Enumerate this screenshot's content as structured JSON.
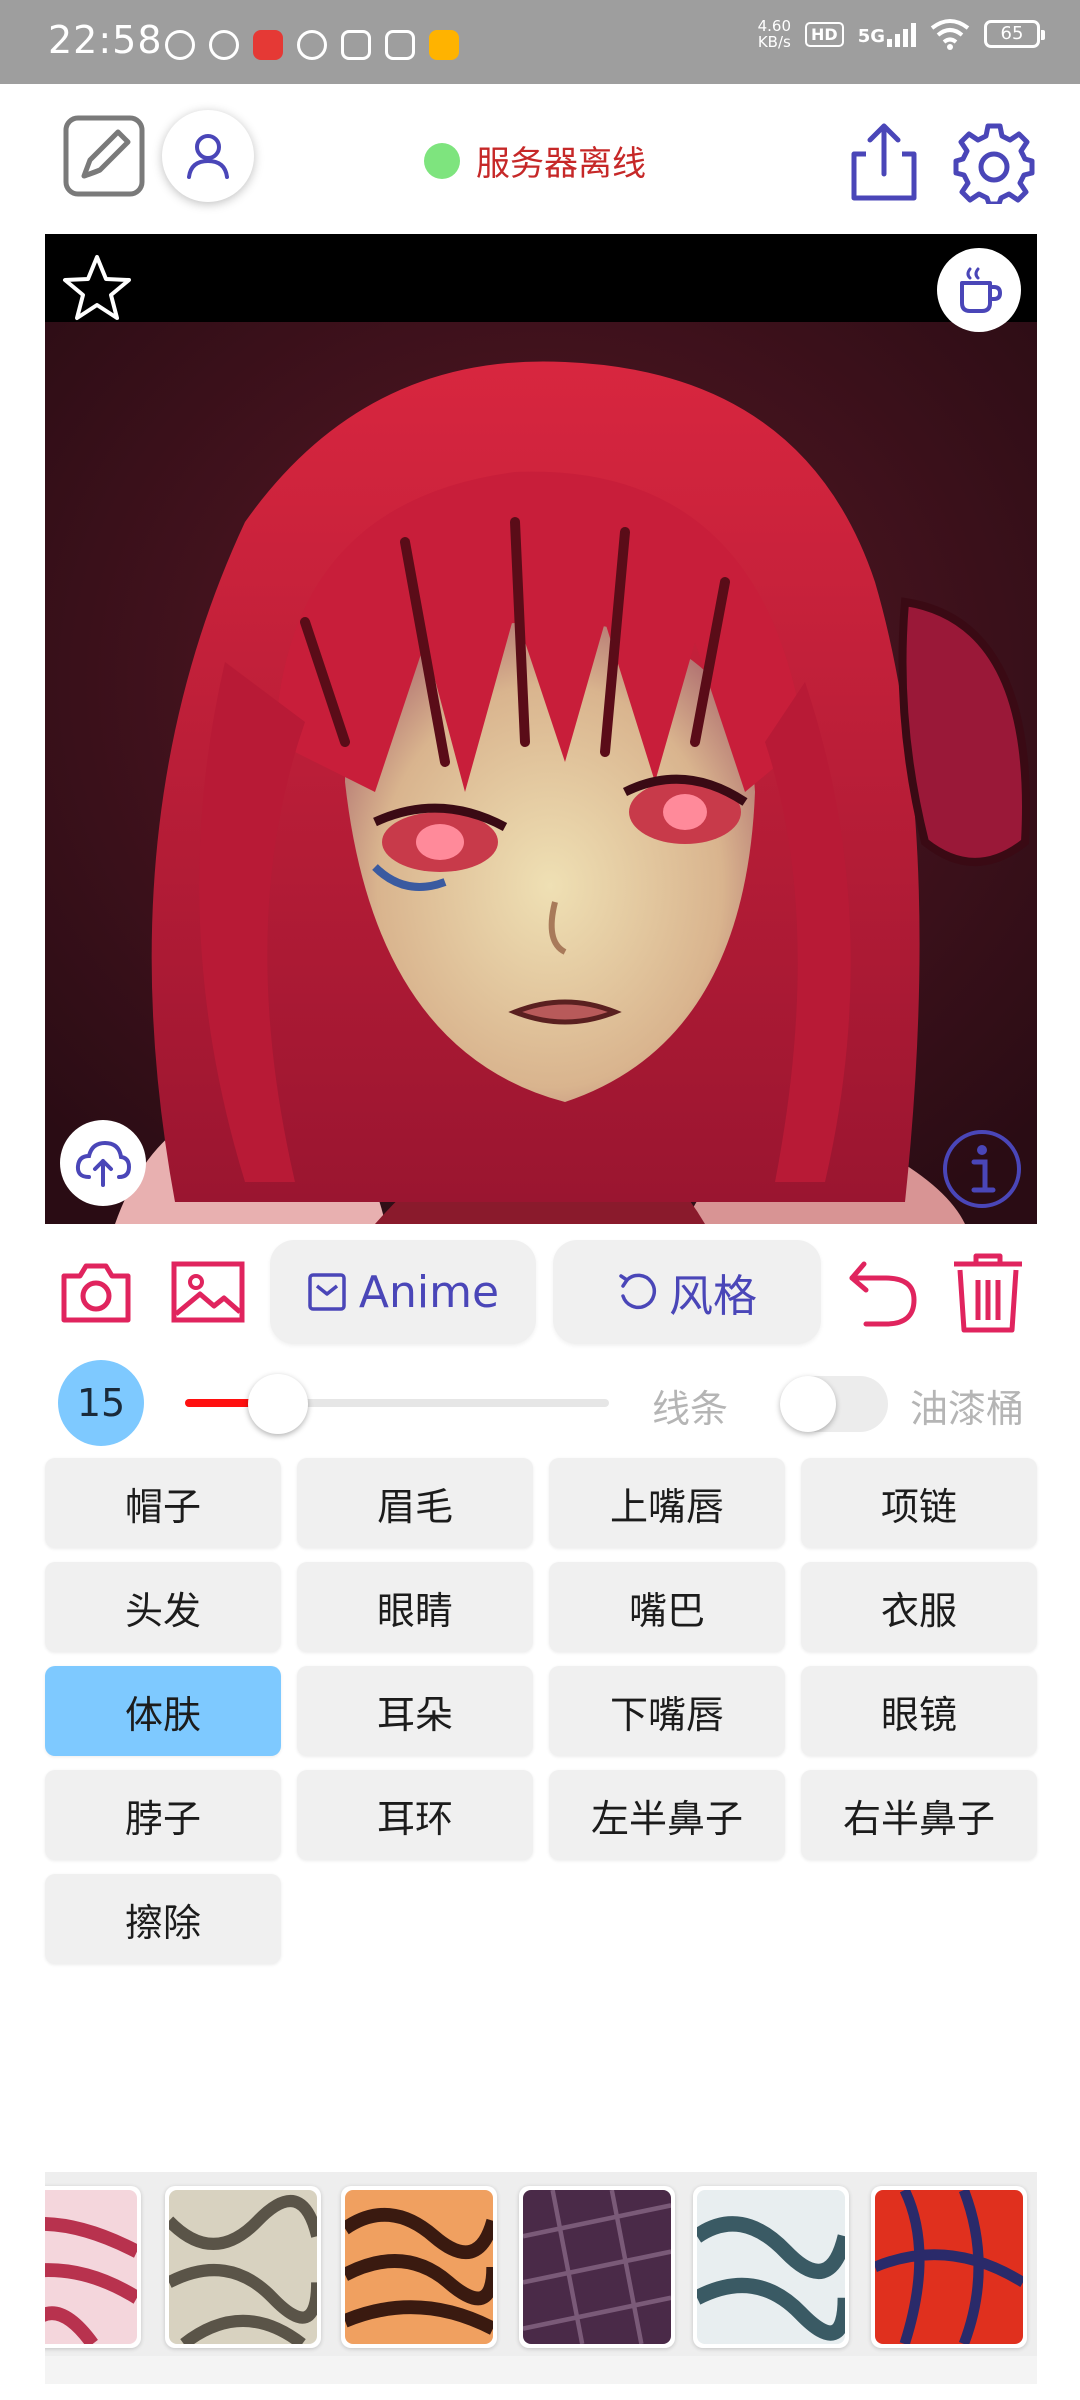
{
  "status_bar": {
    "time": "22:58",
    "net_speed_value": "4.60",
    "net_speed_unit": "KB/s",
    "hd_badge": "HD",
    "network": "5G",
    "battery": "65",
    "icons": [
      "wifi-icon",
      "battery-icon"
    ]
  },
  "header": {
    "server_status": "服务器离线",
    "status_color": "#7ee47e",
    "icons": [
      "edit-icon",
      "profile-icon",
      "share-icon",
      "settings-icon"
    ]
  },
  "canvas": {
    "icons": [
      "star-icon",
      "coffee-icon",
      "cloud-upload-icon",
      "info-icon"
    ]
  },
  "actions": {
    "model_label": "Anime",
    "style_label": "风格",
    "icons": [
      "camera-icon",
      "image-icon",
      "model-icon",
      "refresh-icon",
      "undo-icon",
      "trash-icon"
    ]
  },
  "brush": {
    "size": "15",
    "slider_value_fraction": 0.19,
    "line_label": "线条",
    "bucket_label": "油漆桶",
    "bucket_enabled": false
  },
  "parts": [
    {
      "label": "帽子",
      "active": false
    },
    {
      "label": "眉毛",
      "active": false
    },
    {
      "label": "上嘴唇",
      "active": false
    },
    {
      "label": "项链",
      "active": false
    },
    {
      "label": "头发",
      "active": false
    },
    {
      "label": "眼睛",
      "active": false
    },
    {
      "label": "嘴巴",
      "active": false
    },
    {
      "label": "衣服",
      "active": false
    },
    {
      "label": "体肤",
      "active": true
    },
    {
      "label": "耳朵",
      "active": false
    },
    {
      "label": "下嘴唇",
      "active": false
    },
    {
      "label": "眼镜",
      "active": false
    },
    {
      "label": "脖子",
      "active": false
    },
    {
      "label": "耳环",
      "active": false
    },
    {
      "label": "左半鼻子",
      "active": false
    },
    {
      "label": "右半鼻子",
      "active": false
    },
    {
      "label": "擦除",
      "active": false
    }
  ],
  "colors": {
    "accent": "#4a46b8",
    "danger": "#e0245e",
    "selected": "#7ec9ff",
    "slider": "#ff1010",
    "offline_text": "#c62828"
  }
}
